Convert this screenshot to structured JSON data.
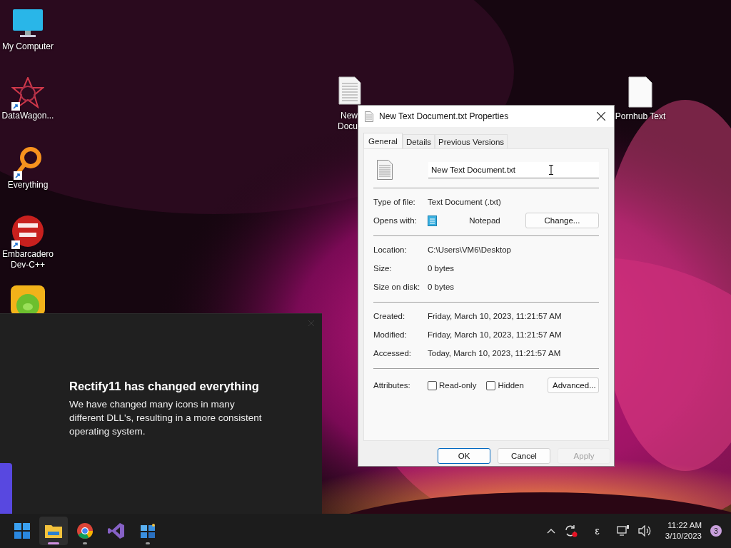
{
  "desktop_icons": [
    {
      "kind": "monitor",
      "shortcut": false,
      "label": [
        "My Computer"
      ]
    },
    {
      "kind": "star",
      "shortcut": true,
      "label": [
        "DataWagon..."
      ]
    },
    {
      "kind": "ring",
      "shortcut": true,
      "label": [
        "Everything"
      ]
    },
    {
      "kind": "dev",
      "shortcut": true,
      "label": [
        "Embarcadero",
        "Dev-C++"
      ]
    },
    {
      "kind": "pig",
      "shortcut": false
    }
  ],
  "partial_file_icon": {
    "label": [
      "New",
      "Docu"
    ]
  },
  "file_icon": {
    "label": [
      "Pornhub Text"
    ]
  },
  "notification": {
    "title": "Rectify11 has changed everything",
    "body": "We have changed many icons in many different DLL's, resulting in a more consistent operating system."
  },
  "dialog": {
    "title": "New Text Document.txt Properties",
    "tabs": [
      {
        "label": "General",
        "selected": true
      },
      {
        "label": "Details",
        "selected": false
      },
      {
        "label": "Previous Versions",
        "selected": false
      }
    ],
    "file_name": "New Text Document.txt",
    "sections": [
      [
        {
          "kind": "text",
          "label": "Type of file:",
          "value": "Text Document (.txt)"
        },
        {
          "kind": "app",
          "label": "Opens with:",
          "value": "Notepad",
          "button": "Change..."
        }
      ],
      [
        {
          "kind": "text",
          "label": "Location:",
          "value": "C:\\Users\\VM6\\Desktop"
        },
        {
          "kind": "text",
          "label": "Size:",
          "value": "0 bytes"
        },
        {
          "kind": "text",
          "label": "Size on disk:",
          "value": "0 bytes"
        }
      ],
      [
        {
          "kind": "text",
          "label": "Created:",
          "value": "Friday, March 10, 2023, 11:21:57 AM"
        },
        {
          "kind": "text",
          "label": "Modified:",
          "value": "Friday, March 10, 2023, 11:21:57 AM"
        },
        {
          "kind": "text",
          "label": "Accessed:",
          "value": "Today, March 10, 2023, 11:21:57 AM"
        }
      ]
    ],
    "attributes": {
      "label": "Attributes:",
      "checkboxes": [
        {
          "label": "Read-only",
          "checked": false
        },
        {
          "label": "Hidden",
          "checked": false
        }
      ],
      "button": "Advanced..."
    },
    "buttons": [
      {
        "label": "OK",
        "default": true,
        "disabled": false
      },
      {
        "label": "Cancel",
        "default": false,
        "disabled": false
      },
      {
        "label": "Apply",
        "default": false,
        "disabled": true
      }
    ]
  },
  "taskbar": {
    "apps": [
      {
        "kind": "start",
        "active": false,
        "running": false
      },
      {
        "kind": "folder",
        "active": true,
        "running": true
      },
      {
        "kind": "chrome",
        "active": false,
        "running": true
      },
      {
        "kind": "vs",
        "active": false,
        "running": false
      },
      {
        "kind": "tiles",
        "active": false,
        "running": true
      }
    ],
    "language": "ε",
    "time": "11:22 AM",
    "date": "3/10/2023",
    "notifications": "3"
  }
}
